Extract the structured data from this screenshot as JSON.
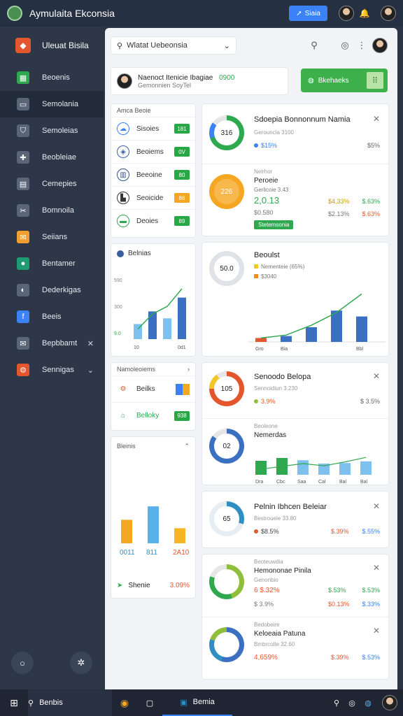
{
  "app": {
    "title": "Aymulaita Ekconsia",
    "button_label": "Siaia"
  },
  "sidebar": {
    "header": "Uleuat Bisila",
    "items": [
      {
        "label": "Beoenis",
        "icon": "table-icon",
        "color": "#2fa84f"
      },
      {
        "label": "Semolania",
        "icon": "inbox-icon",
        "color": "#5a6577"
      },
      {
        "label": "Semoleias",
        "icon": "shield-icon",
        "color": "#5a6577"
      },
      {
        "label": "Beobleiae",
        "icon": "puzzle-icon",
        "color": "#5a6577"
      },
      {
        "label": "Cemepies",
        "icon": "calendar-icon",
        "color": "#5a6577"
      },
      {
        "label": "Bomnoila",
        "icon": "tools-icon",
        "color": "#5a6577"
      },
      {
        "label": "Seiians",
        "icon": "mail-icon",
        "color": "#f0a030"
      },
      {
        "label": "Bentamer",
        "icon": "user-icon",
        "color": "#1e9b73"
      },
      {
        "label": "Dederkigas",
        "icon": "chat-icon",
        "color": "#5a6577"
      },
      {
        "label": "Beeis",
        "icon": "facebook-icon",
        "color": "#3b82f6"
      },
      {
        "label": "Bepbbamt",
        "icon": "envelope-icon",
        "color": "#5a6577"
      },
      {
        "label": "Sennigas",
        "icon": "settings-icon",
        "color": "#e4572e"
      }
    ]
  },
  "search": {
    "value": "Wlatat Uebeonsia"
  },
  "profile": {
    "name": "Naenoct Itenicie Ibagiae",
    "value": "0900",
    "subtitle": "Gemonnien SoyTel"
  },
  "action_button": {
    "label": "Bkehaeks"
  },
  "left_panel": {
    "title": "Amca Beoie",
    "rows": [
      {
        "label": "Sisoies",
        "value": "181",
        "icon": "cloud-icon"
      },
      {
        "label": "Beoiems",
        "value": "0V",
        "icon": "drop-icon"
      },
      {
        "label": "Beeoine",
        "value": "80",
        "icon": "building-icon"
      },
      {
        "label": "Seoicide",
        "value": "86",
        "icon": "factory-icon"
      },
      {
        "label": "Deoies",
        "value": "89",
        "icon": "truck-icon"
      }
    ]
  },
  "mini_chart": {
    "title": "Belnias",
    "chart_data": {
      "type": "bar",
      "categories": [
        "10",
        "",
        "",
        "0d1"
      ],
      "values": [
        24,
        44,
        33,
        66
      ],
      "line": [
        16,
        40,
        52,
        80
      ],
      "ylabels": [
        "590",
        "300",
        "9.0"
      ],
      "ylim": [
        0,
        100
      ]
    }
  },
  "small_list": {
    "title": "Namoleoiems",
    "rows": [
      {
        "label": "Beilks",
        "icon": "gear-icon"
      },
      {
        "label": "Belloky",
        "value": "938",
        "icon": "home-icon"
      }
    ]
  },
  "bottom_left": {
    "title": "Bleinis",
    "chart_data": {
      "type": "bar",
      "categories": [
        "0011",
        "811",
        "2A10"
      ],
      "values": [
        28,
        44,
        18
      ],
      "colors": [
        "#f5a623",
        "#5ab0e8",
        "#f5b623"
      ]
    },
    "footer_label": "Shenie",
    "footer_value": "3.09%"
  },
  "cards": {
    "c1": {
      "ring_value": "316",
      "title": "Sdoepia Bonnonnum Namia",
      "subtitle": "Gerouncia 3100",
      "amount": "$15%",
      "right": "$5%"
    },
    "c2": {
      "ring_value": "226",
      "label": "Nelrhor",
      "title": "Peroeie",
      "subtitle": "Gerlicoie 3.43",
      "big": "2,0.13",
      "v1": "$4,33%",
      "v2": "$.63%",
      "small": "$0.580",
      "r1": "$2.13%",
      "r2": "$.63%",
      "tag": "Stetemsonia"
    },
    "c3": {
      "ring_value": "50.0",
      "title": "Beoulst",
      "legend1": "Nementeie (65%)",
      "legend2": "$3040",
      "chart_data": {
        "type": "bar",
        "categories": [
          "Gro",
          "Bia",
          "",
          "",
          "Bbl"
        ],
        "values": [
          8,
          12,
          30,
          64,
          52
        ],
        "line": [
          8,
          14,
          34,
          60,
          98
        ],
        "ylim": [
          0,
          100
        ]
      }
    },
    "c4": {
      "ring_value": "105",
      "title": "Senoodo Belopa",
      "subtitle": "Sennoidiun 3.230",
      "amount": "3.9%",
      "right": "$ 3.5%"
    },
    "c5": {
      "ring_value": "02",
      "label": "Beoleone",
      "title": "Nemerdas",
      "chart_data": {
        "type": "bar",
        "categories": [
          "Dra",
          "Cbc",
          "Saa",
          "Cal",
          "Bal",
          "Bal"
        ],
        "values": [
          50,
          60,
          52,
          40,
          42,
          48
        ],
        "line": [
          20,
          30,
          40,
          32,
          46,
          62
        ],
        "ylim": [
          0,
          100
        ]
      }
    },
    "c6": {
      "ring_value": "65",
      "title": "Pelnin Ibhcen Beleiar",
      "subtitle": "Bestroueie 33.80",
      "amount": "$8.5%",
      "v1": "$.39%",
      "v2": "$.55%"
    },
    "c7": {
      "label": "Beoteuwdia",
      "title": "Hemononae Pinila",
      "subtitle": "Genonbio",
      "amount": "6 $.32%",
      "v1": "$.53%",
      "v2": "$.53%",
      "small": "$ 3.9%",
      "r1": "$0.13%",
      "r2": "$.33%"
    },
    "c8": {
      "label": "Bedobeire",
      "title": "Keloeaia Patuna",
      "subtitle": "Bmbrcolte 32.60",
      "amount": "4,659%",
      "v1": "$.39%",
      "v2": "$.53%"
    }
  },
  "taskbar": {
    "search_label": "Benbis",
    "app_label": "Bemia"
  },
  "colors": {
    "green": "#2fa84f",
    "blue": "#3b82f6",
    "orange": "#f5a623",
    "red": "#e4572e",
    "teal": "#5ab0e8"
  }
}
